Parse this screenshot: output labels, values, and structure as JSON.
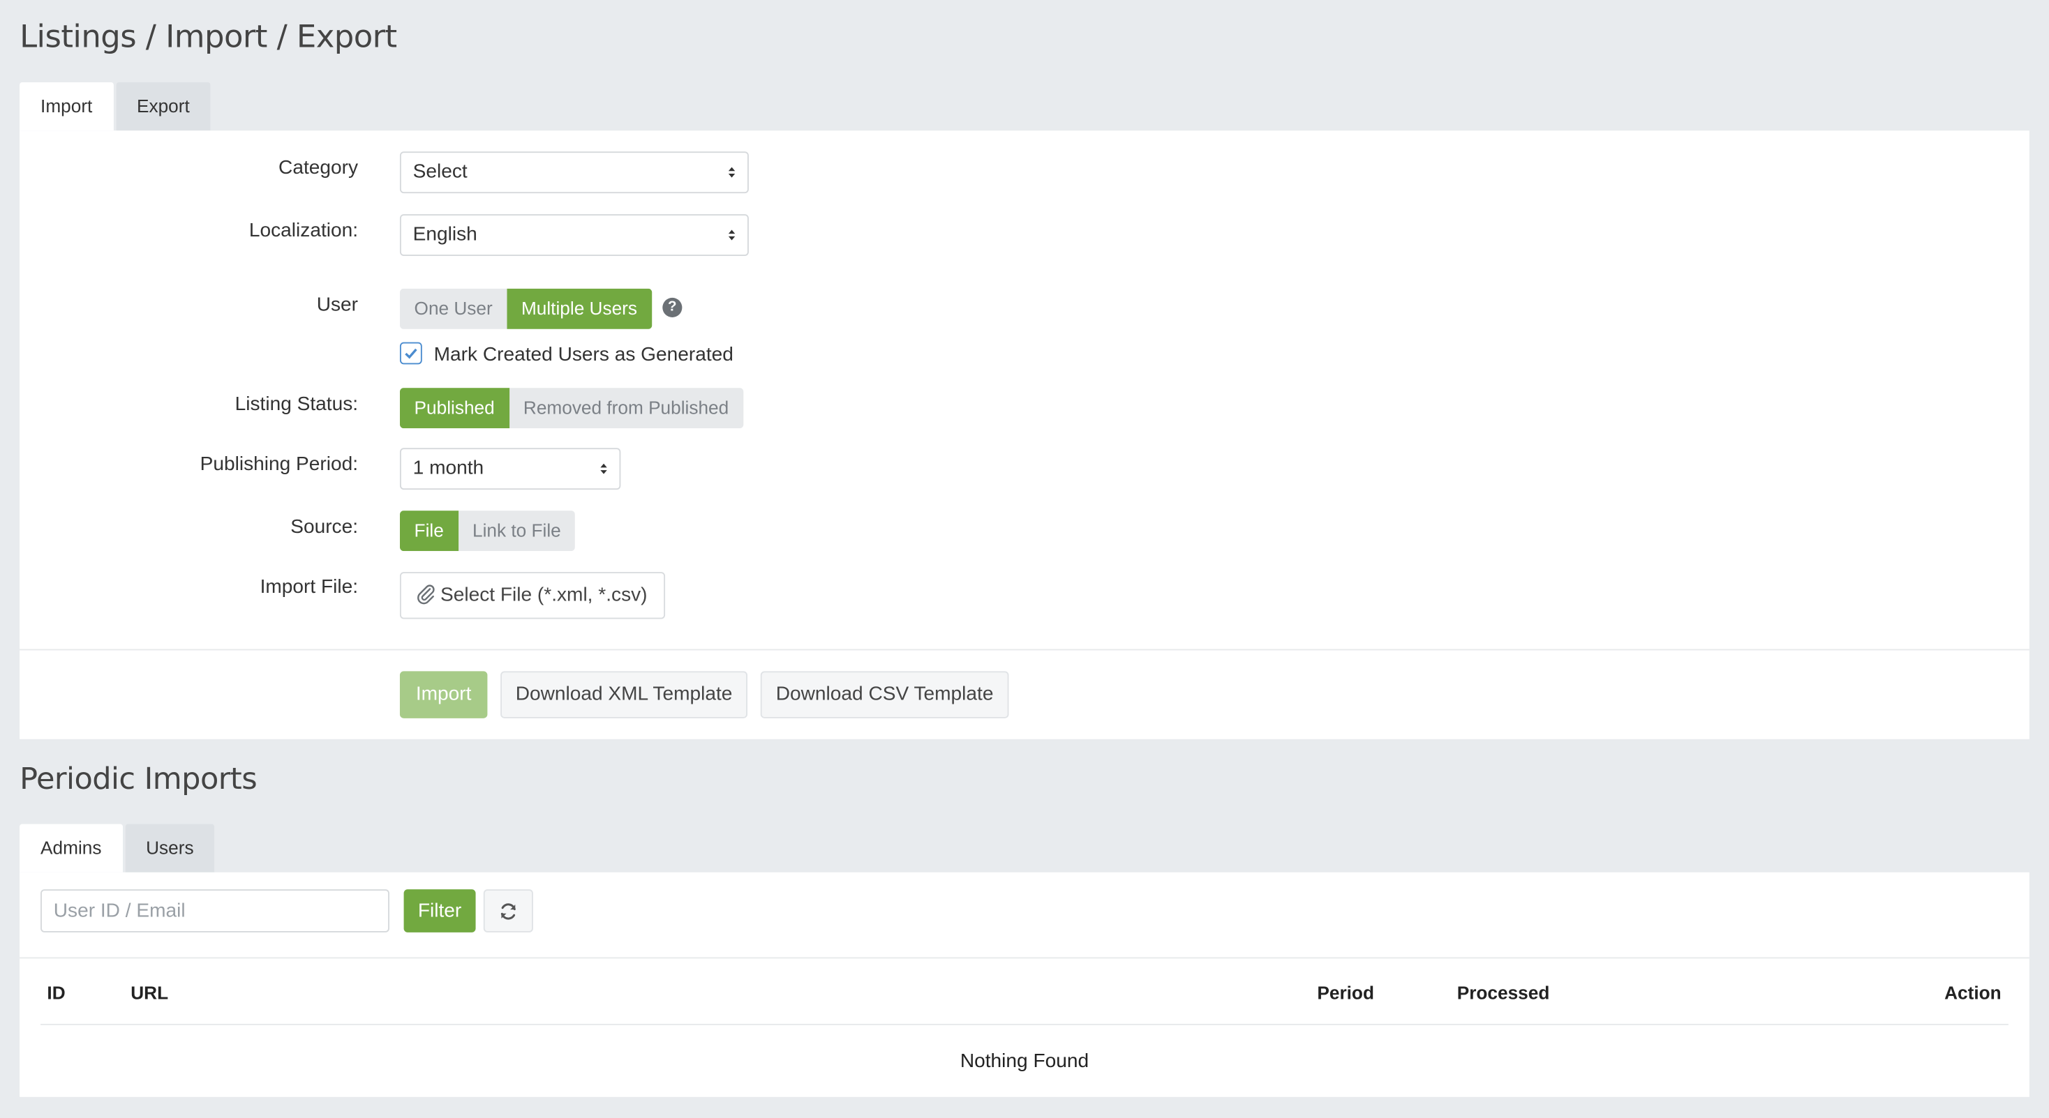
{
  "page": {
    "title": "Listings / Import / Export"
  },
  "main_tabs": [
    {
      "label": "Import"
    },
    {
      "label": "Export"
    }
  ],
  "form": {
    "category": {
      "label": "Category",
      "value": "Select"
    },
    "localization": {
      "label": "Localization:",
      "value": "English"
    },
    "user": {
      "label": "User",
      "options": [
        {
          "label": "One User",
          "selected": false
        },
        {
          "label": "Multiple Users",
          "selected": true
        }
      ],
      "help_icon": "question-circle-icon",
      "checkbox": {
        "label": "Mark Created Users as Generated",
        "checked": true
      }
    },
    "listing_status": {
      "label": "Listing Status:",
      "options": [
        {
          "label": "Published",
          "selected": true
        },
        {
          "label": "Removed from Published",
          "selected": false
        }
      ]
    },
    "publishing_period": {
      "label": "Publishing Period:",
      "value": "1 month"
    },
    "source": {
      "label": "Source:",
      "options": [
        {
          "label": "File",
          "selected": true
        },
        {
          "label": "Link to File",
          "selected": false
        }
      ]
    },
    "import_file": {
      "label": "Import File:",
      "button": "Select File (*.xml, *.csv)",
      "icon": "paperclip-icon"
    }
  },
  "actions": {
    "import": "Import",
    "xml_template": "Download XML Template",
    "csv_template": "Download CSV Template"
  },
  "periodic": {
    "title": "Periodic Imports",
    "tabs": [
      {
        "label": "Admins"
      },
      {
        "label": "Users"
      }
    ],
    "filter": {
      "placeholder": "User ID / Email",
      "button": "Filter",
      "refresh_icon": "refresh-icon"
    },
    "table": {
      "columns": [
        "ID",
        "URL",
        "Period",
        "Processed",
        "Action"
      ],
      "empty_message": "Nothing Found"
    }
  },
  "colors": {
    "accent": "#72a940",
    "accent_disabled": "#a7cb88",
    "background": "#e8ebee"
  }
}
